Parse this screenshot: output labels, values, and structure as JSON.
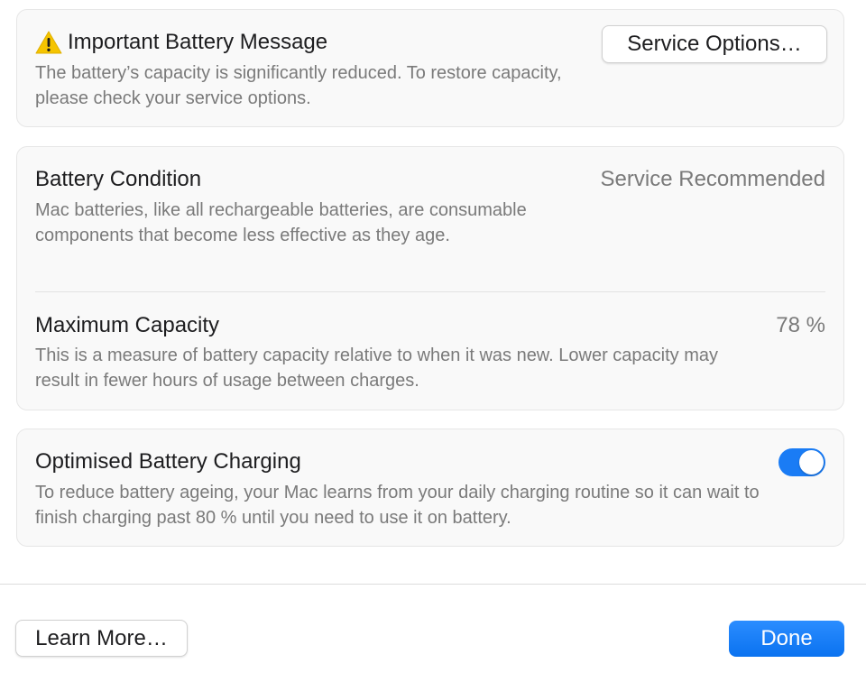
{
  "message": {
    "icon": "warning-triangle-icon",
    "icon_color": "#f5c400",
    "title": "Important Battery Message",
    "description": "The battery’s capacity is significantly reduced. To restore capacity, please check your service options.",
    "service_button": "Service Options…"
  },
  "condition": {
    "title": "Battery Condition",
    "value": "Service Recommended",
    "description": "Mac batteries, like all rechargeable batteries, are consumable components that become less effective as they age."
  },
  "capacity": {
    "title": "Maximum Capacity",
    "value": "78 %",
    "description": "This is a measure of battery capacity relative to when it was new. Lower capacity may result in fewer hours of usage between charges."
  },
  "charging": {
    "title": "Optimised Battery Charging",
    "description": "To reduce battery ageing, your Mac learns from your daily charging routine so it can wait to finish charging past 80 % until you need to use it on battery.",
    "enabled": true,
    "toggle_color": "#1a7cf5"
  },
  "footer": {
    "learn_more": "Learn More…",
    "done": "Done"
  }
}
